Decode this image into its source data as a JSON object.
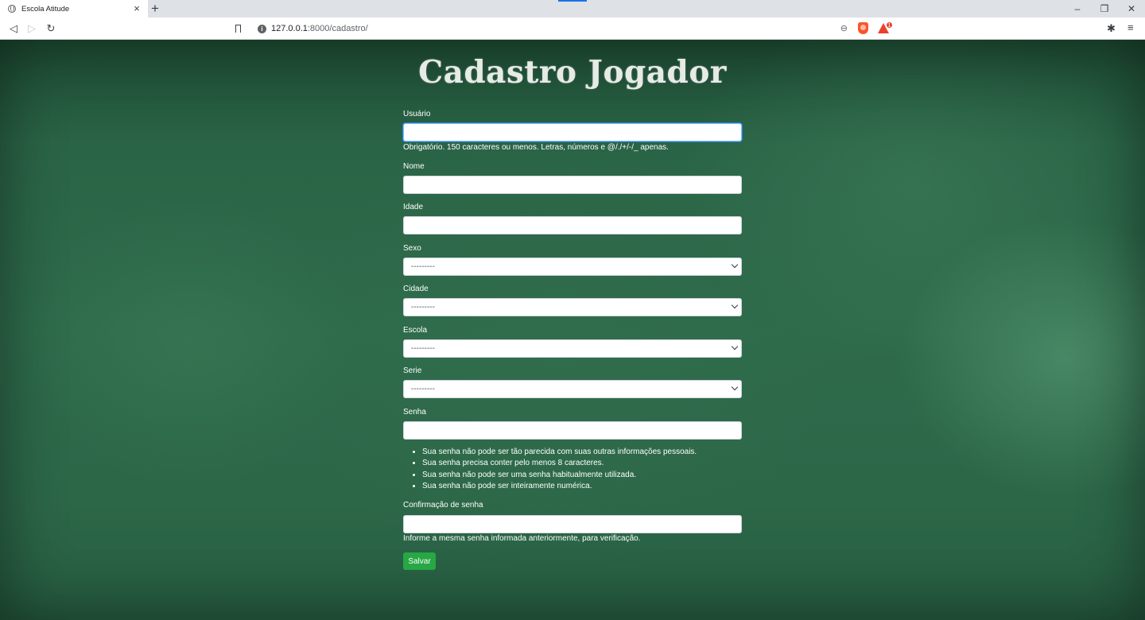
{
  "browser": {
    "tab_title": "Escola Atitude",
    "url_host": "127.0.0.1",
    "url_rest": ":8000/cadastro/",
    "rewards_badge": "1"
  },
  "page": {
    "title": "Cadastro Jogador"
  },
  "form": {
    "usuario": {
      "label": "Usuário",
      "value": "",
      "help": "Obrigatório. 150 caracteres ou menos. Letras, números e @/./+/-/_ apenas."
    },
    "nome": {
      "label": "Nome",
      "value": ""
    },
    "idade": {
      "label": "Idade",
      "value": ""
    },
    "sexo": {
      "label": "Sexo",
      "selected": "---------"
    },
    "cidade": {
      "label": "Cidade",
      "selected": "---------"
    },
    "escola": {
      "label": "Escola",
      "selected": "---------"
    },
    "serie": {
      "label": "Serie",
      "selected": "---------"
    },
    "senha": {
      "label": "Senha",
      "value": "",
      "rules": [
        "Sua senha não pode ser tão parecida com suas outras informações pessoais.",
        "Sua senha precisa conter pelo menos 8 caracteres.",
        "Sua senha não pode ser uma senha habitualmente utilizada.",
        "Sua senha não pode ser inteiramente numérica."
      ]
    },
    "confirmacao": {
      "label": "Confirmação de senha",
      "value": "",
      "help": "Informe a mesma senha informada anteriormente, para verificação."
    },
    "submit_label": "Salvar"
  },
  "colors": {
    "chalkboard": "#2d6b4a",
    "button": "#28a745",
    "focus": "#80bdff"
  }
}
